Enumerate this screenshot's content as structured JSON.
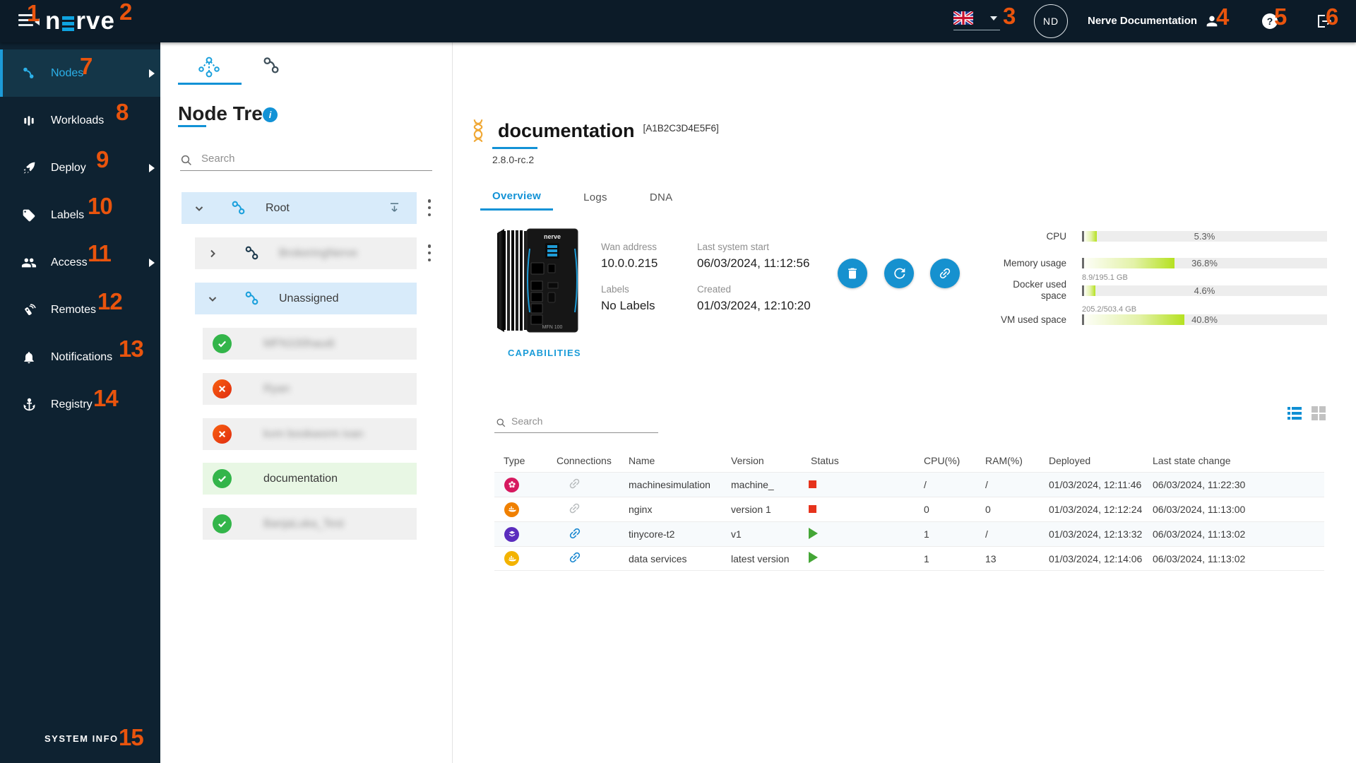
{
  "topbar": {
    "logo_part1": "n",
    "logo_part2": "rve",
    "user_initials": "ND",
    "user_name": "Nerve Documentation"
  },
  "annotations": {
    "color": "#e9540d",
    "labels": [
      "1",
      "2",
      "3",
      "4",
      "5",
      "6",
      "7",
      "8",
      "9",
      "10",
      "11",
      "12",
      "13",
      "14",
      "15"
    ]
  },
  "sidebar": {
    "items": [
      {
        "label": "Nodes",
        "icon": "nodes-icon",
        "active": true,
        "has_submenu": true
      },
      {
        "label": "Workloads",
        "icon": "workloads-icon",
        "active": false,
        "has_submenu": false
      },
      {
        "label": "Deploy",
        "icon": "deploy-icon",
        "active": false,
        "has_submenu": true
      },
      {
        "label": "Labels",
        "icon": "labels-icon",
        "active": false,
        "has_submenu": false
      },
      {
        "label": "Access",
        "icon": "access-icon",
        "active": false,
        "has_submenu": true
      },
      {
        "label": "Remotes",
        "icon": "remotes-icon",
        "active": false,
        "has_submenu": false
      },
      {
        "label": "Notifications",
        "icon": "notifications-icon",
        "active": false,
        "has_submenu": false
      },
      {
        "label": "Registry",
        "icon": "registry-icon",
        "active": false,
        "has_submenu": false
      }
    ],
    "system_info_label": "SYSTEM INFO"
  },
  "node_tree": {
    "title": "Node Tree",
    "search_placeholder": "Search",
    "rows": [
      {
        "kind": "group",
        "label": "Root",
        "expanded": true,
        "blurred": false
      },
      {
        "kind": "group",
        "label": "BrokeringNerve",
        "expanded": false,
        "blurred": true
      },
      {
        "kind": "group",
        "label": "Unassigned",
        "expanded": true,
        "blurred": false
      },
      {
        "kind": "node",
        "label": "MFN100haudi",
        "status": "online",
        "blurred": true
      },
      {
        "kind": "node",
        "label": "Ryan",
        "status": "offline",
        "blurred": true
      },
      {
        "kind": "node",
        "label": "kvm bookworm ivan",
        "status": "offline",
        "blurred": true
      },
      {
        "kind": "node",
        "label": "documentation",
        "status": "online",
        "blurred": false
      },
      {
        "kind": "node",
        "label": "BanjaLuka_Test",
        "status": "online",
        "blurred": true
      }
    ]
  },
  "node_details": {
    "name": "documentation",
    "serial": "[A1B2C3D4E5F6]",
    "version": "2.8.0-rc.2",
    "device_label": "nerve",
    "tabs": [
      {
        "label": "Overview",
        "active": true
      },
      {
        "label": "Logs",
        "active": false
      },
      {
        "label": "DNA",
        "active": false
      }
    ],
    "fields": [
      {
        "label": "Wan address",
        "value": "10.0.0.215"
      },
      {
        "label": "Last system start",
        "value": "06/03/2024, 11:12:56"
      },
      {
        "label": "Labels",
        "value": "No Labels"
      },
      {
        "label": "Created",
        "value": "01/03/2024, 12:10:20"
      }
    ],
    "capabilities_label": "CAPABILITIES",
    "metrics": [
      {
        "label": "CPU",
        "value": "5.3%",
        "pct": 5.3
      },
      {
        "label": "Memory usage",
        "value": "36.8%",
        "pct": 36.8
      },
      {
        "label": "Docker used space",
        "value": "4.6%",
        "pct": 4.6,
        "caption": "8.9/195.1 GB"
      },
      {
        "label": "VM used space",
        "value": "40.8%",
        "pct": 40.8,
        "caption": "205.2/503.4 GB"
      }
    ],
    "accent_color": "#1292d6"
  },
  "workloads": {
    "search_placeholder": "Search",
    "columns": [
      "Type",
      "Connections",
      "Name",
      "Version",
      "Status",
      "CPU(%)",
      "RAM(%)",
      "Deployed",
      "Last state change"
    ],
    "rows": [
      {
        "type": "codesys",
        "type_color": "#d6195f",
        "connected": false,
        "name": "machinesimulation",
        "version": "machine_",
        "status": "stopped",
        "cpu": "/",
        "ram": "/",
        "deployed": "01/03/2024, 12:11:46",
        "last_state_change": "06/03/2024, 11:22:30"
      },
      {
        "type": "docker",
        "type_color": "#f08000",
        "connected": false,
        "name": "nginx",
        "version": "version 1",
        "status": "stopped",
        "cpu": "0",
        "ram": "0",
        "deployed": "01/03/2024, 12:12:24",
        "last_state_change": "06/03/2024, 11:13:00"
      },
      {
        "type": "vm",
        "type_color": "#5b2dbe",
        "connected": true,
        "name": "tinycore-t2",
        "version": "v1",
        "status": "running",
        "cpu": "1",
        "ram": "/",
        "deployed": "01/03/2024, 12:13:32",
        "last_state_change": "06/03/2024, 11:13:02"
      },
      {
        "type": "docker-compose",
        "type_color": "#f3b300",
        "connected": true,
        "name": "data services",
        "version": "latest version",
        "status": "running",
        "cpu": "1",
        "ram": "13",
        "deployed": "01/03/2024, 12:14:06",
        "last_state_change": "06/03/2024, 11:13:02"
      }
    ]
  }
}
